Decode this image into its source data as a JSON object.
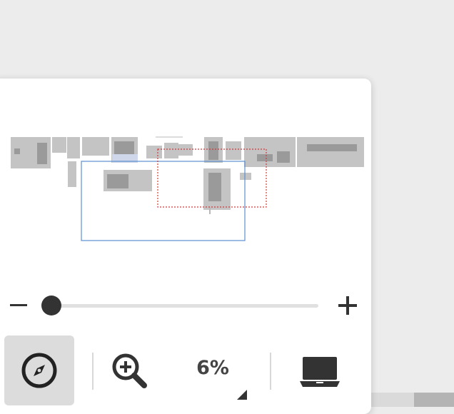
{
  "zoom": {
    "value_label": "6%",
    "slider_fraction": 0.0
  },
  "toolbar": {
    "navigator_icon": "compass-icon",
    "zoom_in_icon": "zoom-in-icon",
    "device_icon": "laptop-icon",
    "zoom_out_icon": "minus-icon",
    "zoom_plus_icon": "plus-icon"
  },
  "colors": {
    "viewport_frame": "#5b8fd0",
    "selection_frame": "#d13a3a",
    "panel_background": "#ffffff",
    "active_button": "#dcdcdc"
  }
}
